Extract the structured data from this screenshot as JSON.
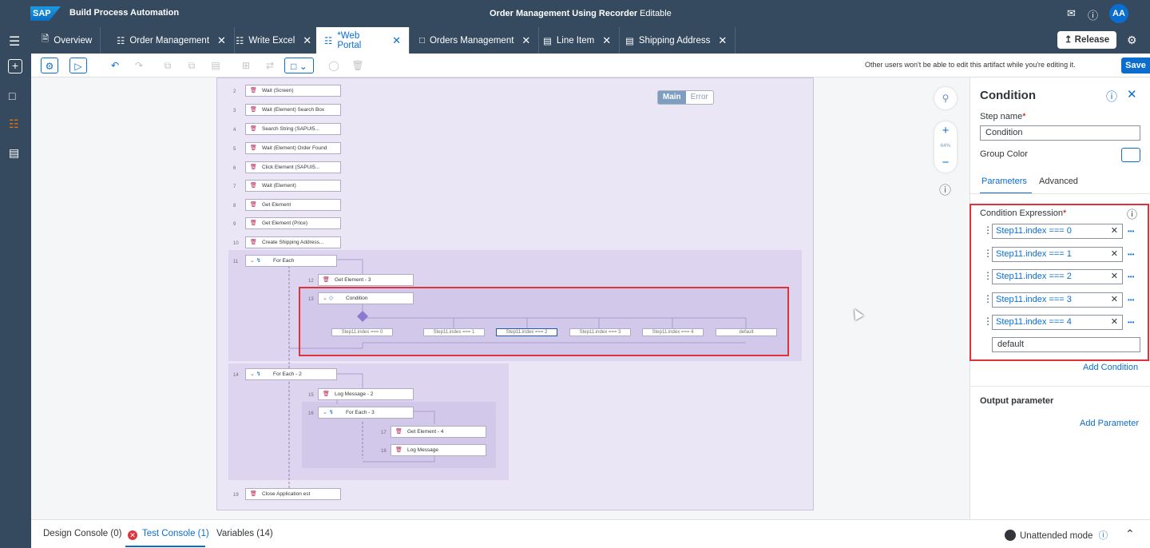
{
  "shell": {
    "logo": "SAP",
    "product": "Build Process Automation",
    "title": "Order Management Using Recorder",
    "status": "Editable",
    "avatar": "AA"
  },
  "tabs": [
    {
      "label": "Overview",
      "icon": "document-icon"
    },
    {
      "label": "Order Management",
      "icon": "process-icon"
    },
    {
      "label": "Write Excel",
      "icon": "process-icon"
    },
    {
      "label": "*Web Portal",
      "icon": "process-icon"
    },
    {
      "label": "Orders Management",
      "icon": "monitor-icon"
    },
    {
      "label": "Line Item",
      "icon": "list-icon"
    },
    {
      "label": "Shipping Address",
      "icon": "list-icon"
    }
  ],
  "release_label": "Release",
  "toolbar": {
    "note": "Other users won't be able to edit this artifact while you're editing it.",
    "save": "Save"
  },
  "flow": {
    "toggle": {
      "main": "Main",
      "error": "Error"
    },
    "steps": [
      {
        "num": "2",
        "label": "Wait (Screen)"
      },
      {
        "num": "3",
        "label": "Wait (Element) Search Box"
      },
      {
        "num": "4",
        "label": "Search String (SAPUI5..."
      },
      {
        "num": "5",
        "label": "Wait (Element) Order Found"
      },
      {
        "num": "6",
        "label": "Click Element (SAPUI5..."
      },
      {
        "num": "7",
        "label": "Wait (Element)"
      },
      {
        "num": "8",
        "label": "Get Element"
      },
      {
        "num": "9",
        "label": "Get Element (Price)"
      },
      {
        "num": "10",
        "label": "Create Shipping Address..."
      },
      {
        "num": "11",
        "label": "For Each"
      },
      {
        "num": "12",
        "label": "Get Element - 3"
      },
      {
        "num": "13",
        "label": "Condition"
      },
      {
        "num": "14",
        "label": "For Each - 2"
      },
      {
        "num": "15",
        "label": "Log Message - 2"
      },
      {
        "num": "16",
        "label": "For Each - 3"
      },
      {
        "num": "17",
        "label": "Get Element - 4"
      },
      {
        "num": "18",
        "label": "Log Message"
      },
      {
        "num": "19",
        "label": "Close Application est"
      }
    ],
    "branches": [
      "Step11.index === 0",
      "Step11.index === 1",
      "Step11.index === 2",
      "Step11.index === 3",
      "Step11.index === 4",
      "default"
    ],
    "zoom": "64%"
  },
  "panel": {
    "title": "Condition",
    "step_name_label": "Step name",
    "step_name_value": "Condition",
    "group_color_label": "Group Color",
    "tab_parameters": "Parameters",
    "tab_advanced": "Advanced",
    "cond_expr_label": "Condition Expression",
    "expressions": [
      "Step11.index === 0",
      "Step11.index === 1",
      "Step11.index === 2",
      "Step11.index === 3",
      "Step11.index === 4"
    ],
    "default_value": "default",
    "add_condition": "Add Condition",
    "output_label": "Output parameter",
    "add_parameter": "Add Parameter"
  },
  "bottom": {
    "design": "Design Console (0)",
    "test": "Test Console (1)",
    "variables": "Variables (14)",
    "mode": "Unattended mode"
  },
  "colors": {
    "shell": "#354a5f",
    "accent": "#0a6ed1",
    "highlight": "#e0323b"
  }
}
